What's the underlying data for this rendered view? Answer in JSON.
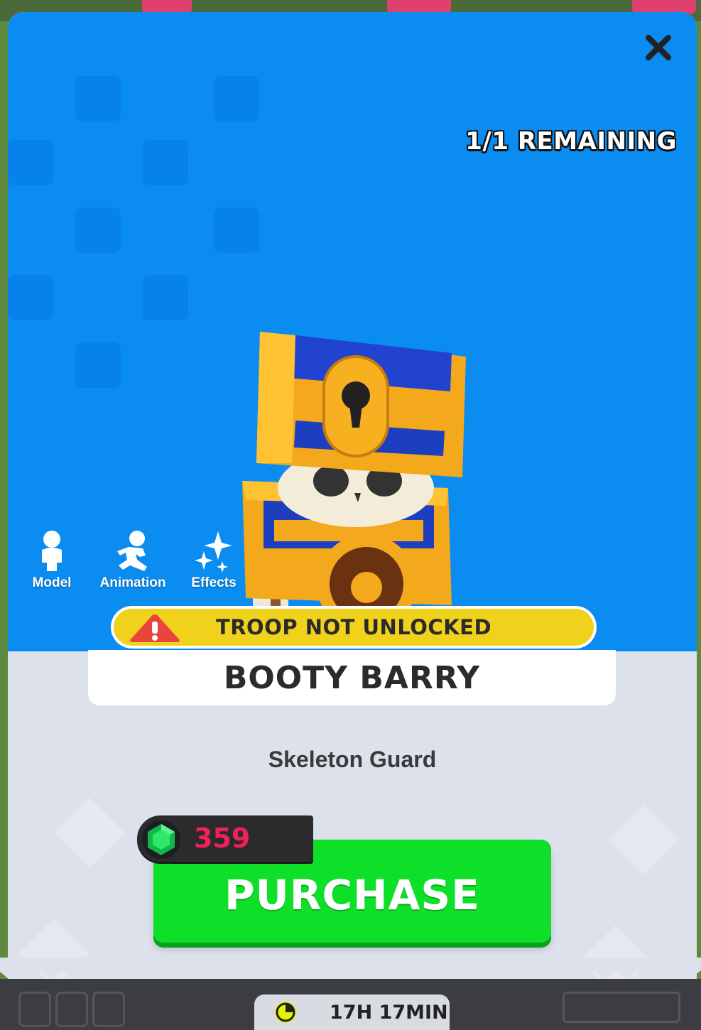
{
  "offer": {
    "remaining": "1/1 REMAINING",
    "warning": "TROOP NOT UNLOCKED",
    "name": "BOOTY BARRY",
    "subtitle": "Skeleton Guard"
  },
  "view_tools": [
    {
      "label": "Model",
      "icon": "person-icon"
    },
    {
      "label": "Animation",
      "icon": "running-person-icon"
    },
    {
      "label": "Effects",
      "icon": "sparkles-icon"
    }
  ],
  "purchase": {
    "label": "PURCHASE",
    "price": "359",
    "currency_icon": "green-gem-icon"
  },
  "timer": {
    "text": "17H 17MIN",
    "icon": "clock-icon"
  },
  "colors": {
    "hero_bg": "#0a8cf0",
    "warning_bg": "#f0d21c",
    "purchase_bg": "#0ee02a",
    "price_text": "#f0205a",
    "timer_icon": "#e6f20a"
  }
}
